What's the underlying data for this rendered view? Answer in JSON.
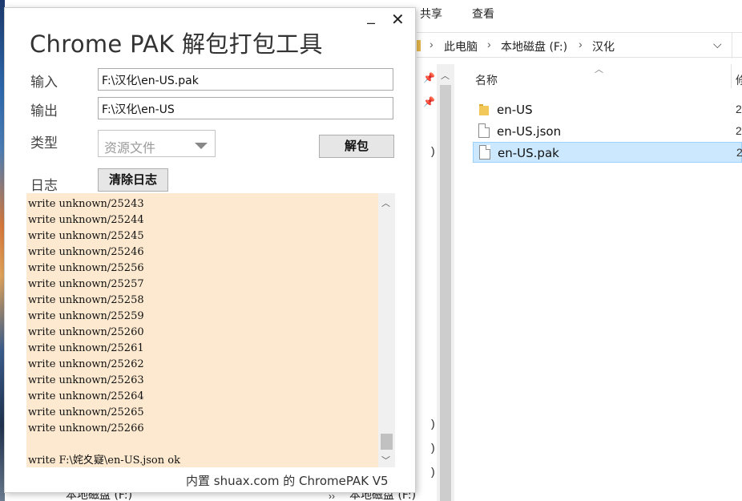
{
  "explorer": {
    "ribbon_tabs": [
      "共享",
      "查看"
    ],
    "breadcrumb": [
      "此电脑",
      "本地磁盘 (F:)",
      "汉化"
    ],
    "list_header": "名称",
    "next_column": "修",
    "files": [
      {
        "name": "en-US",
        "type": "folder",
        "trunc": "2"
      },
      {
        "name": "en-US.json",
        "type": "file",
        "trunc": "2"
      },
      {
        "name": "en-US.pak",
        "type": "file",
        "trunc": "2"
      }
    ],
    "nav_parens": [
      ")",
      ")",
      ")",
      ")"
    ],
    "bottom_left": "本地磁盘 (F:)",
    "bottom_right": "本地磁盘 (F:)"
  },
  "tool": {
    "title": "Chrome PAK 解包打包工具",
    "input_label": "输入",
    "input_value": "F:\\汉化\\en-US.pak",
    "output_label": "输出",
    "output_value": "F:\\汉化\\en-US",
    "type_label": "类型",
    "type_value": "资源文件",
    "unpack_button": "解包",
    "log_label": "日志",
    "clear_log_button": "清除日志",
    "log_lines": [
      "write unknown/25243",
      "write unknown/25244",
      "write unknown/25245",
      "write unknown/25246",
      "write unknown/25256",
      "write unknown/25257",
      "write unknown/25258",
      "write unknown/25259",
      "write unknown/25260",
      "write unknown/25261",
      "write unknown/25262",
      "write unknown/25263",
      "write unknown/25264",
      "write unknown/25265",
      "write unknown/25266",
      "",
      "write F:\\姹夊寲\\en-US.json ok"
    ],
    "footer": "内置 shuax.com 的 ChromePAK V5"
  }
}
